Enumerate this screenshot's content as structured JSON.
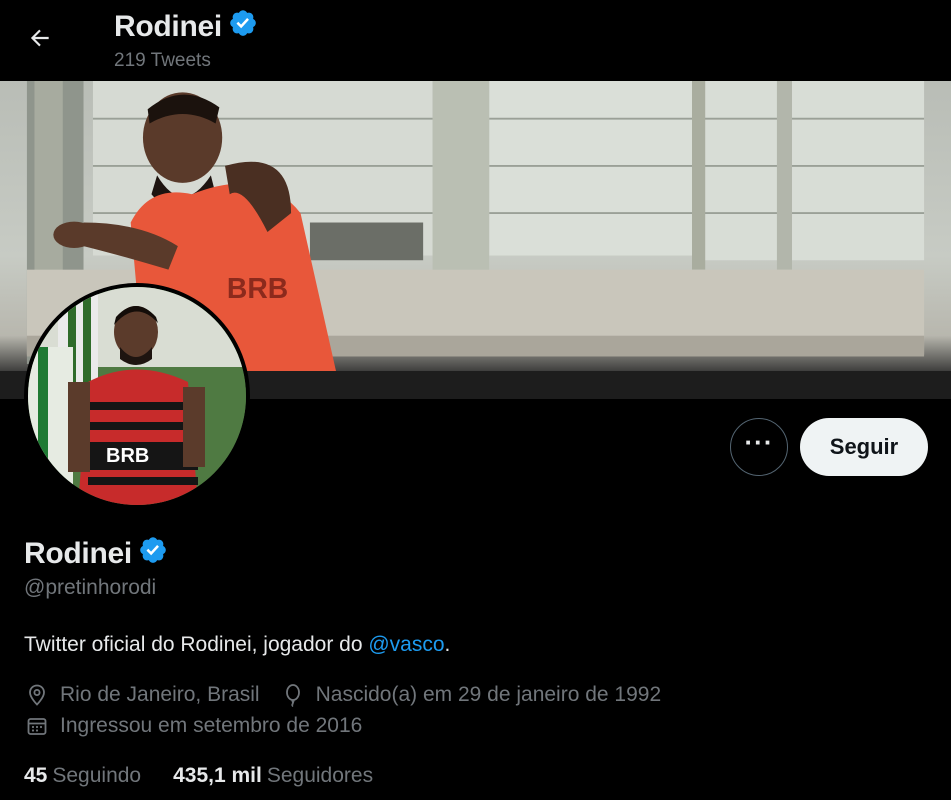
{
  "header": {
    "back_icon": "arrow-left-icon",
    "name": "Rodinei",
    "tweet_count": "219 Tweets"
  },
  "profile": {
    "name": "Rodinei",
    "handle": "@pretinhorodi",
    "verified": true,
    "bio_text": "Twitter oficial do Rodinei, jogador do ",
    "bio_mention": "@vasco",
    "bio_end": ".",
    "location": "Rio de Janeiro, Brasil",
    "birth": "Nascido(a) em 29 de janeiro de 1992",
    "joined": "Ingressou em setembro de 2016"
  },
  "actions": {
    "more_label": "···",
    "follow_label": "Seguir"
  },
  "stats": {
    "following_count": "45",
    "following_label": "Seguindo",
    "followers_count": "435,1 mil",
    "followers_label": "Seguidores"
  },
  "colors": {
    "background": "#000000",
    "text_primary": "#e7e9ea",
    "text_secondary": "#71767b",
    "accent": "#1d9bf0",
    "follow_button_bg": "#eff3f4"
  }
}
